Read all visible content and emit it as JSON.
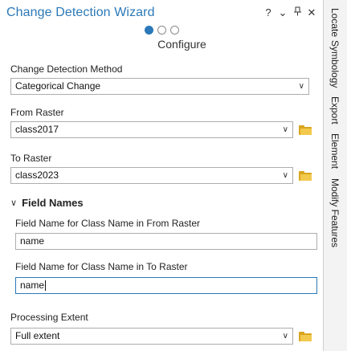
{
  "title": "Change Detection Wizard",
  "controls": {
    "help": "?",
    "menu": "⌄",
    "pin": "⊥",
    "close": "✕"
  },
  "step": {
    "label": "Configure",
    "count": 3,
    "current": 1
  },
  "method": {
    "label": "Change Detection Method",
    "value": "Categorical Change"
  },
  "from_raster": {
    "label": "From Raster",
    "value": "class2017"
  },
  "to_raster": {
    "label": "To Raster",
    "value": "class2023"
  },
  "field_names": {
    "header": "Field Names",
    "from_label": "Field Name for Class Name in From Raster",
    "from_value": "name",
    "to_label": "Field Name for Class Name in To Raster",
    "to_value": "name"
  },
  "extent": {
    "label": "Processing Extent",
    "value": "Full extent"
  },
  "dock_tabs": [
    "Locate",
    "Symbology",
    "Export",
    "Element",
    "Modify Features"
  ],
  "colors": {
    "accent": "#2b79b8",
    "folder": "#f2c94c"
  }
}
